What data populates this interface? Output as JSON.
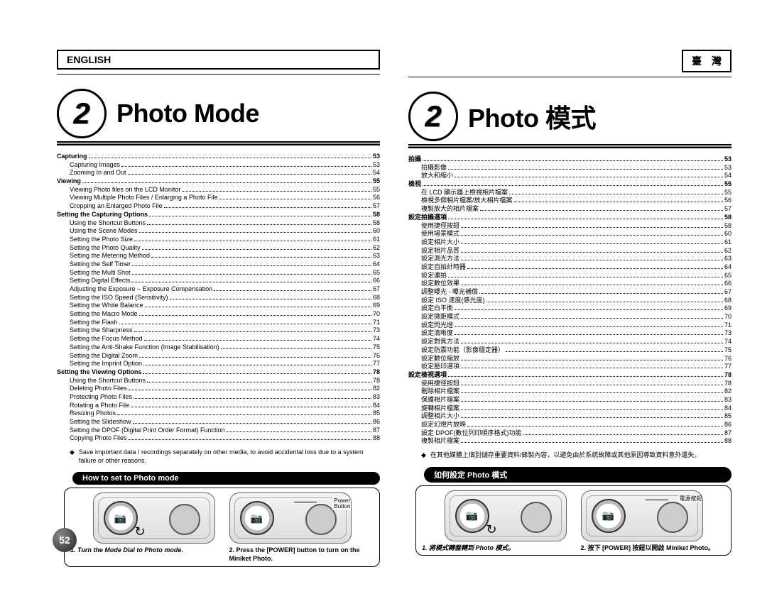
{
  "left": {
    "lang_tab": "ENGLISH",
    "chapter_num": "2",
    "chapter_title": "Photo Mode",
    "toc": [
      {
        "label": "Capturing",
        "page": "53",
        "bold": true,
        "indent": 0
      },
      {
        "label": "Capturing Images",
        "page": "53",
        "indent": 1
      },
      {
        "label": "Zooming In and Out",
        "page": "54",
        "indent": 1
      },
      {
        "label": "Viewing",
        "page": "55",
        "bold": true,
        "indent": 0
      },
      {
        "label": "Viewing Photo files on the LCD Monitor",
        "page": "55",
        "indent": 1
      },
      {
        "label": "Viewing Multiple Photo Files / Enlarging a Photo File",
        "page": "56",
        "indent": 1
      },
      {
        "label": "Cropping an Enlarged Photo File",
        "page": "57",
        "indent": 1
      },
      {
        "label": "Setting the Capturing Options",
        "page": "58",
        "bold": true,
        "indent": 0
      },
      {
        "label": "Using the Shortcut Buttons",
        "page": "58",
        "indent": 1
      },
      {
        "label": "Using the Scene Modes",
        "page": "60",
        "indent": 1
      },
      {
        "label": "Setting the Photo Size",
        "page": "61",
        "indent": 1
      },
      {
        "label": "Setting the Photo Quality",
        "page": "62",
        "indent": 1
      },
      {
        "label": "Setting the Metering Method",
        "page": "63",
        "indent": 1
      },
      {
        "label": "Setting the Self Timer",
        "page": "64",
        "indent": 1
      },
      {
        "label": "Setting the Multi Shot",
        "page": "65",
        "indent": 1
      },
      {
        "label": "Setting Digital Effects",
        "page": "66",
        "indent": 1
      },
      {
        "label": "Adjusting the Exposure – Exposure Compensation",
        "page": "67",
        "indent": 1
      },
      {
        "label": "Setting the ISO Speed (Sensitivity)",
        "page": "68",
        "indent": 1
      },
      {
        "label": "Setting the White Balance",
        "page": "69",
        "indent": 1
      },
      {
        "label": "Setting the Macro Mode",
        "page": "70",
        "indent": 1
      },
      {
        "label": "Setting the Flash",
        "page": "71",
        "indent": 1
      },
      {
        "label": "Setting the Sharpness",
        "page": "73",
        "indent": 1
      },
      {
        "label": "Setting the Focus Method",
        "page": "74",
        "indent": 1
      },
      {
        "label": "Setting the Anti-Shake Function (Image Stabilisation)",
        "page": "75",
        "indent": 1
      },
      {
        "label": "Setting the Digital Zoom",
        "page": "76",
        "indent": 1
      },
      {
        "label": "Setting the Imprint Option",
        "page": "77",
        "indent": 1
      },
      {
        "label": "Setting the Viewing Options",
        "page": "78",
        "bold": true,
        "indent": 0
      },
      {
        "label": "Using the Shortcut Buttons",
        "page": "78",
        "indent": 1
      },
      {
        "label": "Deleting Photo Files",
        "page": "82",
        "indent": 1
      },
      {
        "label": "Protecting Photo Files",
        "page": "83",
        "indent": 1
      },
      {
        "label": "Rotating a Photo File",
        "page": "84",
        "indent": 1
      },
      {
        "label": "Resizing Photos",
        "page": "85",
        "indent": 1
      },
      {
        "label": "Setting the Slideshow",
        "page": "86",
        "indent": 1
      },
      {
        "label": "Setting the DPOF (Digital Print Order Format) Function",
        "page": "87",
        "indent": 1
      },
      {
        "label": "Copying Photo Files",
        "page": "88",
        "indent": 1
      }
    ],
    "note": "Save important data / recordings separately on other media, to avoid accidental loss due to a system failure or other reasons.",
    "howto_title": "How to set to Photo mode",
    "power_label": "Power\nButton",
    "step1": "1. Turn the Mode Dial to Photo mode.",
    "step2": "2. Press the [POWER] button to turn on the Miniket Photo.",
    "page_num": "52"
  },
  "right": {
    "lang_tab": "臺　灣",
    "chapter_num": "2",
    "chapter_title": "Photo 模式",
    "toc": [
      {
        "label": "拍攝",
        "page": "53",
        "bold": true,
        "indent": 0
      },
      {
        "label": "拍攝影像",
        "page": "53",
        "indent": 1
      },
      {
        "label": "放大和縮小",
        "page": "54",
        "indent": 1
      },
      {
        "label": "檢視",
        "page": "55",
        "bold": true,
        "indent": 0
      },
      {
        "label": "在 LCD 顯示器上檢視相片檔案",
        "page": "55",
        "indent": 1
      },
      {
        "label": "檢視多個相片檔案/放大相片檔案",
        "page": "56",
        "indent": 1
      },
      {
        "label": "複製放大的相片檔案",
        "page": "57",
        "indent": 1
      },
      {
        "label": "設定拍攝選項",
        "page": "58",
        "bold": true,
        "indent": 0
      },
      {
        "label": "使用捷徑按鈕",
        "page": "58",
        "indent": 1
      },
      {
        "label": "使用場景模式",
        "page": "60",
        "indent": 1
      },
      {
        "label": "設定相片大小",
        "page": "61",
        "indent": 1
      },
      {
        "label": "設定相片品質",
        "page": "62",
        "indent": 1
      },
      {
        "label": "設定測光方法",
        "page": "63",
        "indent": 1
      },
      {
        "label": "設定自拍計時器",
        "page": "64",
        "indent": 1
      },
      {
        "label": "設定連拍",
        "page": "65",
        "indent": 1
      },
      {
        "label": "設定數位效果",
        "page": "66",
        "indent": 1
      },
      {
        "label": "調整曝光 - 曝光補償",
        "page": "67",
        "indent": 1
      },
      {
        "label": "設定 ISO 速度(感光度)",
        "page": "68",
        "indent": 1
      },
      {
        "label": "設定白平衡",
        "page": "69",
        "indent": 1
      },
      {
        "label": "設定微距模式",
        "page": "70",
        "indent": 1
      },
      {
        "label": "設定閃光燈",
        "page": "71",
        "indent": 1
      },
      {
        "label": "設定清晰度",
        "page": "73",
        "indent": 1
      },
      {
        "label": "設定對焦方法",
        "page": "74",
        "indent": 1
      },
      {
        "label": "設定防震功能（影像穩定器）",
        "page": "75",
        "indent": 1
      },
      {
        "label": "設定數位縮放",
        "page": "76",
        "indent": 1
      },
      {
        "label": "設定壓印選項",
        "page": "77",
        "indent": 1
      },
      {
        "label": "設定檢視選項",
        "page": "78",
        "bold": true,
        "indent": 0
      },
      {
        "label": "使用捷徑按鈕",
        "page": "78",
        "indent": 1
      },
      {
        "label": "刪除相片檔案",
        "page": "82",
        "indent": 1
      },
      {
        "label": "保護相片檔案",
        "page": "83",
        "indent": 1
      },
      {
        "label": "旋轉相片檔案",
        "page": "84",
        "indent": 1
      },
      {
        "label": "調整相片大小",
        "page": "85",
        "indent": 1
      },
      {
        "label": "設定幻燈片放映",
        "page": "86",
        "indent": 1
      },
      {
        "label": "設定 DPOF(數位列印順序格式)功能",
        "page": "87",
        "indent": 1
      },
      {
        "label": "複製相片檔案",
        "page": "88",
        "indent": 1
      }
    ],
    "note": "在其他媒體上個別儲存重要資料/錄製內容，以避免由於系統故障或其他原因導致資料意外遺失。",
    "howto_title": "如何設定 Photo 模式",
    "power_label": "電源按鈕",
    "step1": "1. 將模式轉盤轉到 Photo 模式。",
    "step2": "2. 按下 [POWER] 按鈕以開啟 Miniket Photo。"
  }
}
